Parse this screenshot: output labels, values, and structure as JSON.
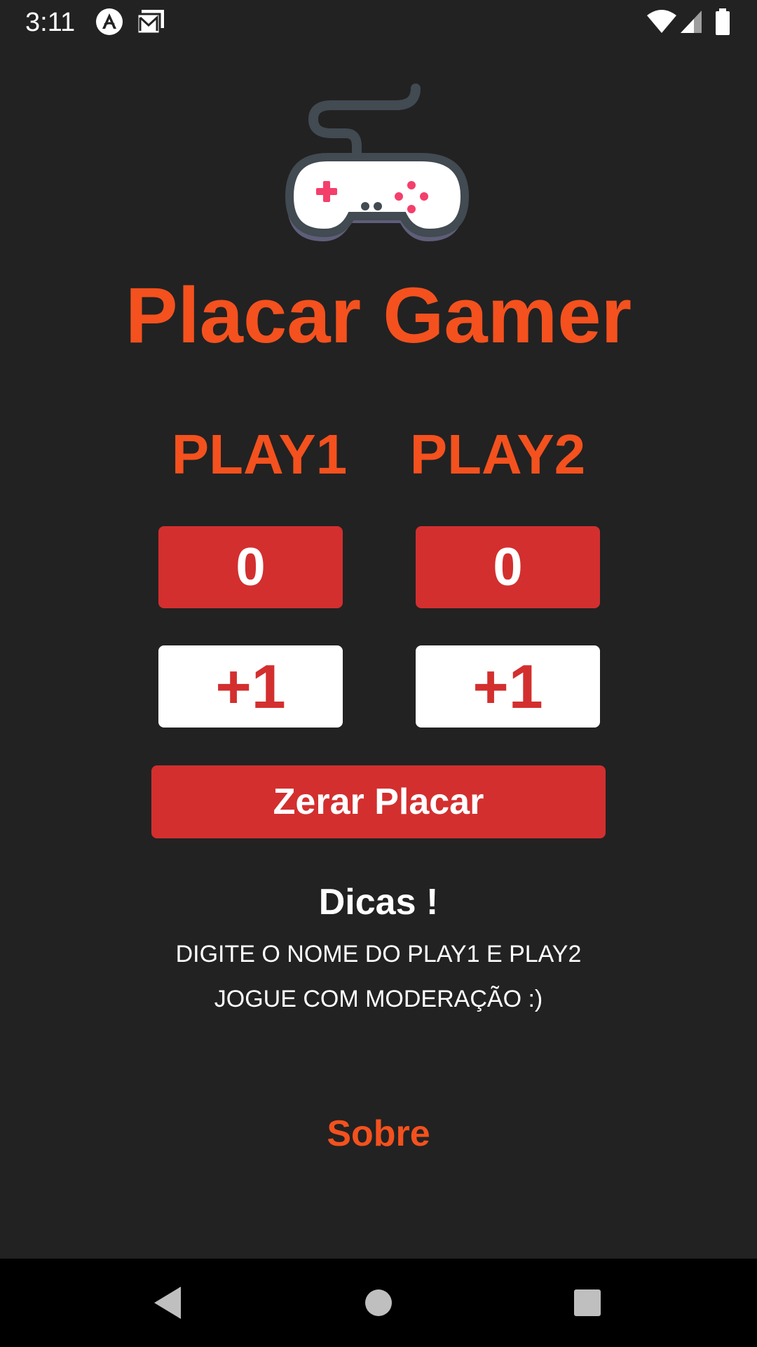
{
  "status_bar": {
    "time": "3:11",
    "icons": [
      "react-native-icon",
      "mail-icon",
      "wifi-icon",
      "signal-icon",
      "battery-icon"
    ]
  },
  "app": {
    "title": "Placar Gamer",
    "logo_icon": "gamepad-icon",
    "accent_color": "#f4511e",
    "score_color": "#d32f2f"
  },
  "players": [
    {
      "label": "PLAY1",
      "score": "0",
      "plus_label": "+1"
    },
    {
      "label": "PLAY2",
      "score": "0",
      "plus_label": "+1"
    }
  ],
  "reset_label": "Zerar Placar",
  "tips": {
    "title": "Dicas !",
    "lines": [
      "DIGITE O NOME DO PLAY1 E PLAY2",
      "JOGUE COM MODERAÇÃO :)"
    ]
  },
  "about_label": "Sobre",
  "nav_bar": {
    "buttons": [
      "back-icon",
      "home-icon",
      "recents-icon"
    ]
  }
}
